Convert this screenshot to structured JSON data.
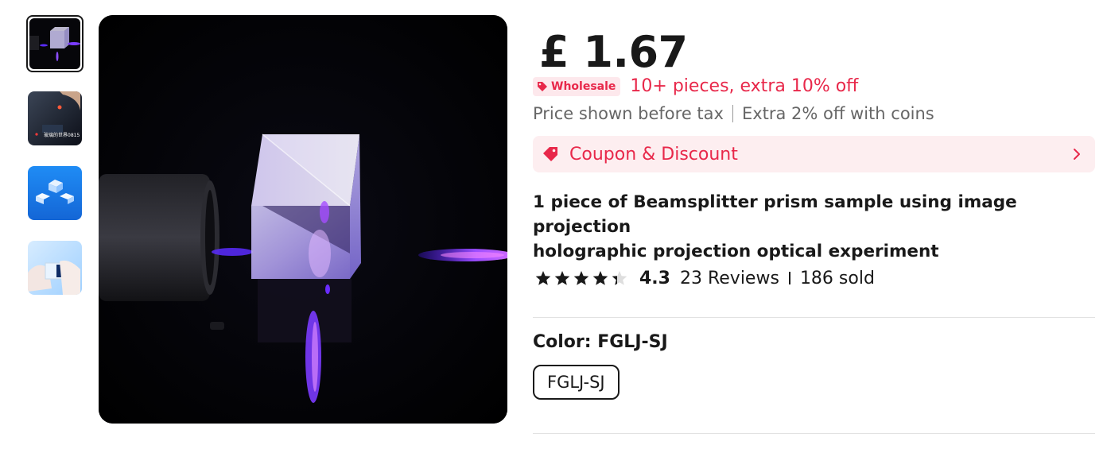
{
  "gallery": {
    "thumbnails": [
      {
        "name": "thumbnail-1",
        "active": true
      },
      {
        "name": "thumbnail-2",
        "active": false,
        "caption": "玻璃的世界0815"
      },
      {
        "name": "thumbnail-3",
        "active": false
      },
      {
        "name": "thumbnail-4",
        "active": false
      }
    ]
  },
  "product": {
    "price": "£ 1.67",
    "wholesale_badge": "Wholesale",
    "wholesale_offer": "10+ pieces, extra 10% off",
    "tax_note": "Price shown before tax",
    "coins_note": "Extra 2% off with coins",
    "coupon_label": "Coupon & Discount",
    "title_line1": "1 piece of Beamsplitter prism sample using image projection",
    "title_line2": "holographic projection optical experiment",
    "rating": "4.3",
    "rating_stars": 4.3,
    "reviews": "23 Reviews",
    "sold": "186 sold",
    "color_label": "Color: FGLJ-SJ",
    "color_option": "FGLJ-SJ"
  },
  "colors": {
    "accent_red": "#e8284a",
    "coupon_bg": "#fdeef0",
    "text_primary": "#191919",
    "text_secondary": "#666666"
  },
  "icons": {
    "wholesale": "tag-icon",
    "coupon": "coupon-tag-icon",
    "chevron": "chevron-right-icon",
    "star": "star-icon"
  }
}
